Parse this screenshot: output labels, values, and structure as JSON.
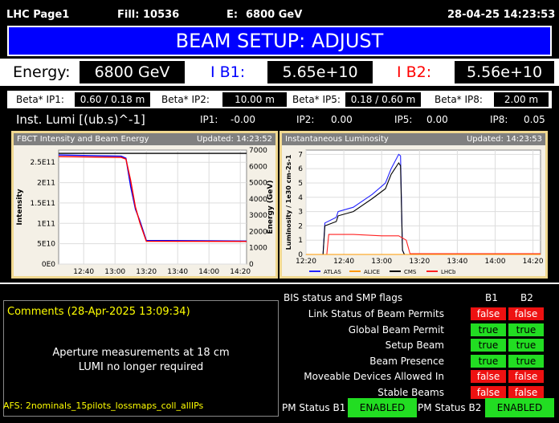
{
  "header": {
    "page": "LHC Page1",
    "fill_label": "Fill:",
    "fill": "10536",
    "energy_label": "E:",
    "energy": "6800 GeV",
    "datetime": "28-04-25 14:23:53"
  },
  "banner": "BEAM SETUP: ADJUST",
  "energy_row": {
    "energy_label": "Energy:",
    "energy_value": "6800 GeV",
    "ib1_label": "I B1:",
    "ib1_value": "5.65e+10",
    "ib2_label": "I B2:",
    "ib2_value": "5.56e+10"
  },
  "beta": [
    {
      "label": "Beta* IP1:",
      "value": "0.60 / 0.18 m"
    },
    {
      "label": "Beta* IP2:",
      "value": "10.00 m"
    },
    {
      "label": "Beta* IP5:",
      "value": "0.18 / 0.60 m"
    },
    {
      "label": "Beta* IP8:",
      "value": "2.00 m"
    }
  ],
  "lumi": {
    "label": "Inst. Lumi [(ub.s)^-1]",
    "ip": [
      {
        "label": "IP1:",
        "value": "-0.00"
      },
      {
        "label": "IP2:",
        "value": "0.00"
      },
      {
        "label": "IP5:",
        "value": "0.00"
      },
      {
        "label": "IP8:",
        "value": "0.05"
      }
    ]
  },
  "colors": {
    "banner": "#0000ff",
    "ib1": "#0000ff",
    "ib2": "#ff0000",
    "flag_true": "#22dd22",
    "flag_false": "#ee1111",
    "comment": "#ffff00"
  },
  "chart_data": [
    {
      "type": "line",
      "title": "FBCT Intensity and Beam Energy",
      "updated": "Updated: 14:23:52",
      "xlabel": "",
      "ylabel": "Intensity",
      "y2label": "Energy (GeV)",
      "x_ticks": [
        "12:40",
        "13:00",
        "13:20",
        "13:40",
        "14:00",
        "14:20"
      ],
      "y_ticks": [
        "0E0",
        "5E10",
        "1E11",
        "1.5E11",
        "2E11",
        "2.5E11"
      ],
      "y2_ticks": [
        "0",
        "1000",
        "2000",
        "3000",
        "4000",
        "5000",
        "6000",
        "7000"
      ],
      "xlim": [
        "12:24",
        "14:24"
      ],
      "ylim": [
        0,
        280000000000.0
      ],
      "y2lim": [
        0,
        7000
      ],
      "series": [
        {
          "name": "B1",
          "color": "#0000ff",
          "x": [
            "12:24",
            "13:04",
            "13:07",
            "13:10",
            "13:13",
            "13:16",
            "13:20",
            "14:24"
          ],
          "values": [
            268000000000.0,
            265000000000.0,
            260000000000.0,
            190000000000.0,
            135000000000.0,
            105000000000.0,
            58000000000.0,
            56500000000.0
          ]
        },
        {
          "name": "B2",
          "color": "#ff0000",
          "x": [
            "12:24",
            "13:04",
            "13:07",
            "13:10",
            "13:13",
            "13:16",
            "13:20",
            "14:24"
          ],
          "values": [
            264000000000.0,
            262000000000.0,
            258000000000.0,
            205000000000.0,
            140000000000.0,
            100000000000.0,
            56000000000.0,
            55600000000.0
          ]
        },
        {
          "name": "Energy",
          "color": "#000000",
          "axis": "y2",
          "x": [
            "12:24",
            "14:24"
          ],
          "values": [
            6800,
            6800
          ]
        }
      ]
    },
    {
      "type": "line",
      "title": "Instantaneous Luminosity",
      "updated": "Updated: 14:23:53",
      "ylabel": "Luminosity / 1e30 cm-2s-1",
      "x_ticks": [
        "12:20",
        "12:40",
        "13:00",
        "13:20",
        "13:40",
        "14:00",
        "14:20"
      ],
      "y_ticks": [
        "0",
        "1",
        "2",
        "3",
        "4",
        "5",
        "6",
        "7"
      ],
      "xlim": [
        "12:20",
        "14:24"
      ],
      "ylim": [
        0,
        7.3
      ],
      "legend": [
        "ATLAS",
        "ALICE",
        "CMS",
        "LHCb"
      ],
      "legend_position": "bottom",
      "series": [
        {
          "name": "ATLAS",
          "color": "#2222ff",
          "x": [
            "12:20",
            "12:29",
            "12:30",
            "12:36",
            "12:37",
            "12:45",
            "12:55",
            "13:02",
            "13:05",
            "13:09",
            "13:10",
            "13:11",
            "13:12"
          ],
          "values": [
            0,
            0,
            2.2,
            2.6,
            3.0,
            3.3,
            4.2,
            5.0,
            6.0,
            7.0,
            6.9,
            0.3,
            0.0
          ]
        },
        {
          "name": "CMS",
          "color": "#000000",
          "x": [
            "12:20",
            "12:29",
            "12:30",
            "12:36",
            "12:37",
            "12:45",
            "12:55",
            "13:02",
            "13:05",
            "13:09",
            "13:10",
            "13:11",
            "13:12"
          ],
          "values": [
            0,
            0,
            2.0,
            2.3,
            2.7,
            3.0,
            3.9,
            4.6,
            5.6,
            6.4,
            6.2,
            0.3,
            0.0
          ]
        },
        {
          "name": "LHCb",
          "color": "#ff2222",
          "x": [
            "12:20",
            "12:31",
            "12:32",
            "12:45",
            "13:00",
            "13:09",
            "13:13",
            "13:15",
            "14:24"
          ],
          "values": [
            0,
            0,
            1.4,
            1.4,
            1.3,
            1.3,
            1.0,
            0.05,
            0.05
          ]
        },
        {
          "name": "ALICE",
          "color": "#ff9900",
          "x": [
            "12:20",
            "14:24"
          ],
          "values": [
            0,
            0
          ]
        }
      ]
    }
  ],
  "bis": {
    "title": "BIS status and SMP flags",
    "col_b1": "B1",
    "col_b2": "B2",
    "flags": [
      {
        "label": "Link Status of Beam Permits",
        "b1": "false",
        "b2": "false"
      },
      {
        "label": "Global Beam Permit",
        "b1": "true",
        "b2": "true"
      },
      {
        "label": "Setup Beam",
        "b1": "true",
        "b2": "true"
      },
      {
        "label": "Beam Presence",
        "b1": "true",
        "b2": "true"
      },
      {
        "label": "Moveable Devices Allowed In",
        "b1": "false",
        "b2": "false"
      },
      {
        "label": "Stable Beams",
        "b1": "false",
        "b2": "false"
      }
    ]
  },
  "comments": {
    "title": "Comments (28-Apr-2025 13:09:34)",
    "line1": "Aperture measurements at 18 cm",
    "line2": "LUMI no longer required"
  },
  "afs": "AFS: 2nominals_15pilots_lossmaps_coll_allIPs",
  "pm": {
    "b1_label": "PM Status B1",
    "b1_value": "ENABLED",
    "b2_label": "PM Status B2",
    "b2_value": "ENABLED"
  }
}
